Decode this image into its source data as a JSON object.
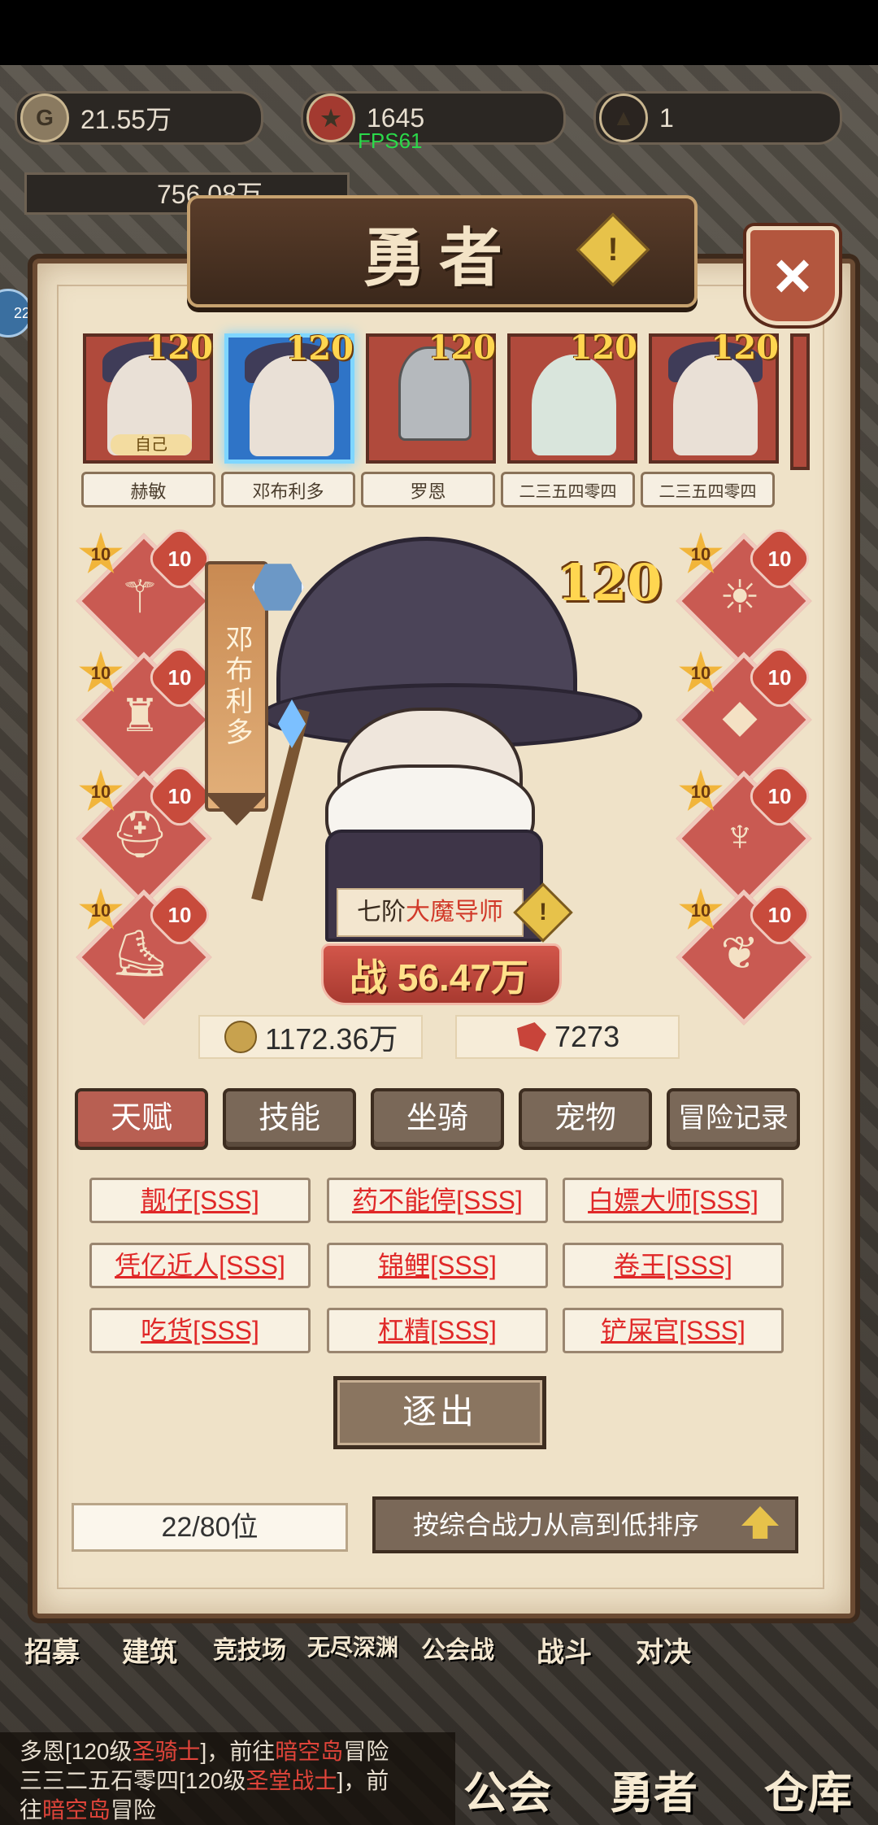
{
  "top_resources": {
    "gold": "21.55万",
    "trophy": "1645",
    "dark": "1"
  },
  "fps": "FPS61",
  "power_total": "756.08万",
  "side_badge": "22",
  "panel": {
    "title": "勇者",
    "info_icon": "!",
    "close_icon": "×"
  },
  "heroes": [
    {
      "name": "赫敏",
      "level": "120",
      "tag": "自己"
    },
    {
      "name": "邓布利多",
      "level": "120",
      "selected": true
    },
    {
      "name": "罗恩",
      "level": "120"
    },
    {
      "name": "二三五四零四",
      "level": "120"
    },
    {
      "name": "二三五四零四",
      "level": "120"
    }
  ],
  "selected_hero": {
    "name": "邓布利多",
    "level": "120",
    "class_prefix": "七阶",
    "class_name": "大魔导师",
    "power_label": "战",
    "power": "56.47万"
  },
  "equipment": {
    "left": [
      {
        "icon": "staff-icon",
        "star": "10",
        "level": "10"
      },
      {
        "icon": "robe-icon",
        "star": "10",
        "level": "10"
      },
      {
        "icon": "helmet-icon",
        "star": "10",
        "level": "10"
      },
      {
        "icon": "boots-icon",
        "star": "10",
        "level": "10"
      }
    ],
    "right": [
      {
        "icon": "amulet-icon",
        "star": "10",
        "level": "10"
      },
      {
        "icon": "ring-icon",
        "star": "10",
        "level": "10"
      },
      {
        "icon": "cape-icon",
        "star": "10",
        "level": "10"
      },
      {
        "icon": "necklace-icon",
        "star": "10",
        "level": "10"
      }
    ]
  },
  "stats": {
    "gold": "1172.36万",
    "medal": "7273"
  },
  "tabs": [
    "天赋",
    "技能",
    "坐骑",
    "宠物",
    "冒险记录"
  ],
  "talents": [
    "靓仔[SSS]",
    "药不能停[SSS]",
    "白嫖大师[SSS]",
    "凭亿近人[SSS]",
    "锦鲤[SSS]",
    "卷王[SSS]",
    "吃货[SSS]",
    "杠精[SSS]",
    "铲屎官[SSS]"
  ],
  "expel_label": "逐出",
  "rank": "22/80位",
  "sort_label": "按综合战力从高到低排序",
  "bottom_nav": [
    "招募",
    "建筑",
    "竞技场",
    "无尽深渊",
    "公会战",
    "战斗",
    "对决"
  ],
  "chat_lines": [
    {
      "a": "多恩[120级",
      "b": "圣骑士",
      "c": "]，前往",
      "d": "暗空岛",
      "e": "冒险"
    },
    {
      "a": "三三二五石零四[120级",
      "b": "圣堂战士",
      "c": "]，前",
      "d": "",
      "e": ""
    },
    {
      "a": "往",
      "b": "暗空岛",
      "c": "冒险",
      "d": "",
      "e": ""
    }
  ],
  "bottom_buttons": [
    "公会",
    "勇者",
    "仓库"
  ],
  "colors": {
    "panel": "#efe2c8",
    "talent_text": "#e02828",
    "active_tab": "#b85f52",
    "selected_card": "#2f74c7"
  }
}
